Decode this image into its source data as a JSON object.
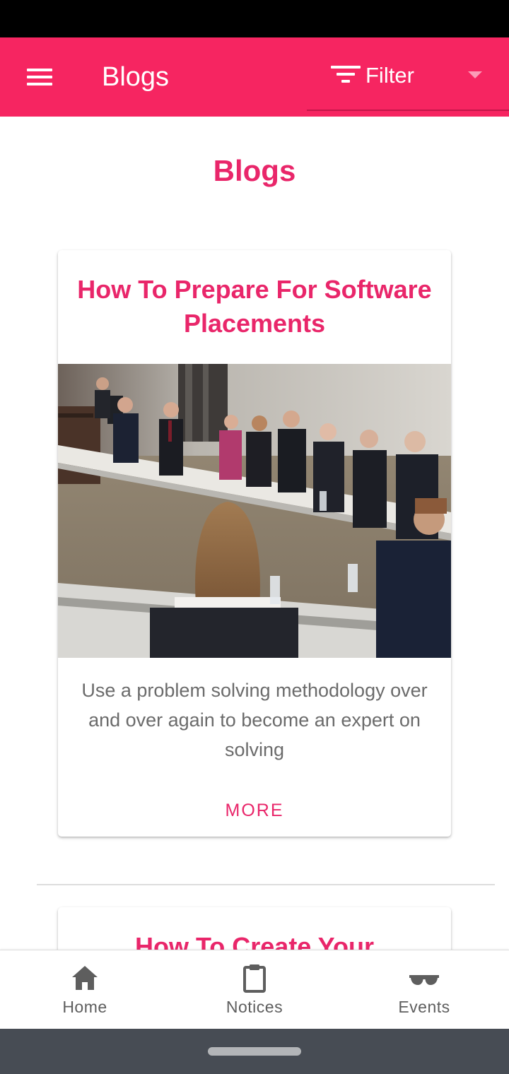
{
  "app_bar": {
    "title": "Blogs",
    "filter_label": "Filter",
    "accent_color": "#f62561"
  },
  "page": {
    "heading": "Blogs"
  },
  "blogs": [
    {
      "title": "How To Prepare For Software Placements",
      "description": "Use a problem solving methodology over and over again to become an expert on solving",
      "more_label": "MORE"
    },
    {
      "title": "How To Create Your"
    }
  ],
  "bottom_nav": {
    "items": [
      {
        "label": "Home",
        "icon": "home-icon"
      },
      {
        "label": "Notices",
        "icon": "clipboard-icon"
      },
      {
        "label": "Events",
        "icon": "sunglasses-icon"
      }
    ]
  }
}
